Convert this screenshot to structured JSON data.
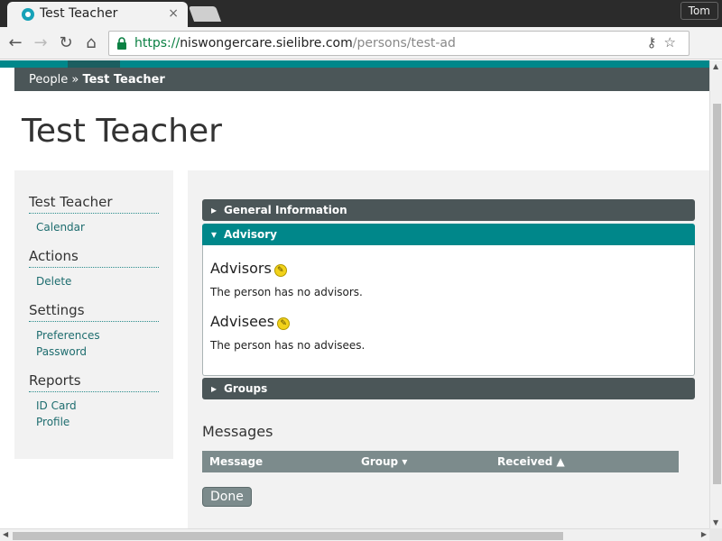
{
  "browser": {
    "tab_title": "Test Teacher",
    "tab_close": "×",
    "profile_name": "Tom",
    "url": {
      "scheme": "https://",
      "host": "niswongercare.sielibre.com",
      "path": "/persons/test-ad"
    },
    "icons": [
      "back-icon",
      "forward-icon",
      "reload-icon",
      "home-icon",
      "lock-icon",
      "key-icon",
      "star-icon"
    ]
  },
  "breadcrumb": {
    "root": "People",
    "separator": "»",
    "current": "Test Teacher"
  },
  "page": {
    "title": "Test Teacher"
  },
  "sidebar": {
    "sections": [
      {
        "heading": "Test Teacher",
        "links": [
          "Calendar"
        ]
      },
      {
        "heading": "Actions",
        "links": [
          "Delete"
        ]
      },
      {
        "heading": "Settings",
        "links": [
          "Preferences",
          "Password"
        ]
      },
      {
        "heading": "Reports",
        "links": [
          "ID Card",
          "Profile"
        ]
      }
    ]
  },
  "accordion": {
    "general": "General Information",
    "advisory": "Advisory",
    "groups": "Groups",
    "advisors_heading": "Advisors",
    "advisors_empty": "The person has no advisors.",
    "advisees_heading": "Advisees",
    "advisees_empty": "The person has no advisees."
  },
  "messages": {
    "title": "Messages",
    "columns": [
      "Message",
      "Group ▾",
      "Received ▲"
    ]
  },
  "done_button": "Done",
  "colors": {
    "teal": "#00878a",
    "dark_header": "#4b5658",
    "table_header": "#7c8b8c"
  }
}
